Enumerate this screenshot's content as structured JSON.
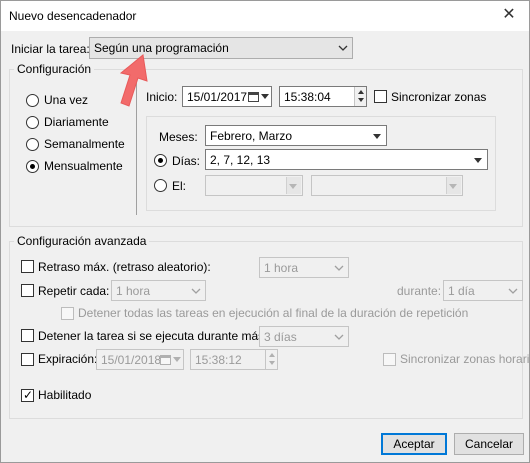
{
  "window": {
    "title": "Nuevo desencadenador",
    "close_glyph": "✕"
  },
  "start_task": {
    "label": "Iniciar la tarea:",
    "value": "Según una programación"
  },
  "configuration": {
    "title": "Configuración",
    "radios": [
      {
        "label": "Una vez",
        "selected": false
      },
      {
        "label": "Diariamente",
        "selected": false
      },
      {
        "label": "Semanalmente",
        "selected": false
      },
      {
        "label": "Mensualmente",
        "selected": true
      }
    ],
    "start_label": "Inicio:",
    "start_date": "15/01/2017",
    "start_time": "15:38:04",
    "sync_zones_label": "Sincronizar zonas",
    "months_label": "Meses:",
    "months_value": "Febrero, Marzo",
    "days_label": "Días:",
    "days_value": "2, 7, 12, 13",
    "on_label": "El:"
  },
  "advanced": {
    "title": "Configuración avanzada",
    "delay_label": "Retraso máx. (retraso aleatorio):",
    "delay_value": "1 hora",
    "repeat_label": "Repetir cada:",
    "repeat_value": "1 hora",
    "duration_label": "durante:",
    "duration_value": "1 día",
    "stop_all_label": "Detener todas las tareas en ejecución al final de la duración de repetición",
    "stop_if_label": "Detener la tarea si se ejecuta durante más de:",
    "stop_if_value": "3 días",
    "expiration_label": "Expiración:",
    "expiration_date": "15/01/2018",
    "expiration_time": "15:38:12",
    "sync_zones_time_label": "Sincronizar zonas horaria",
    "enabled_label": "Habilitado",
    "enabled_checked": true,
    "check_glyph": "✓"
  },
  "buttons": {
    "ok": "Aceptar",
    "cancel": "Cancelar"
  },
  "icons": {
    "calendar": "calendar-icon",
    "dropdown": "chevron-down-icon",
    "spinner": "spinner-icon",
    "annotation": "arrow-annotation"
  },
  "colors": {
    "accent": "#0078d7",
    "annotation_arrow": "#f26b6b"
  }
}
